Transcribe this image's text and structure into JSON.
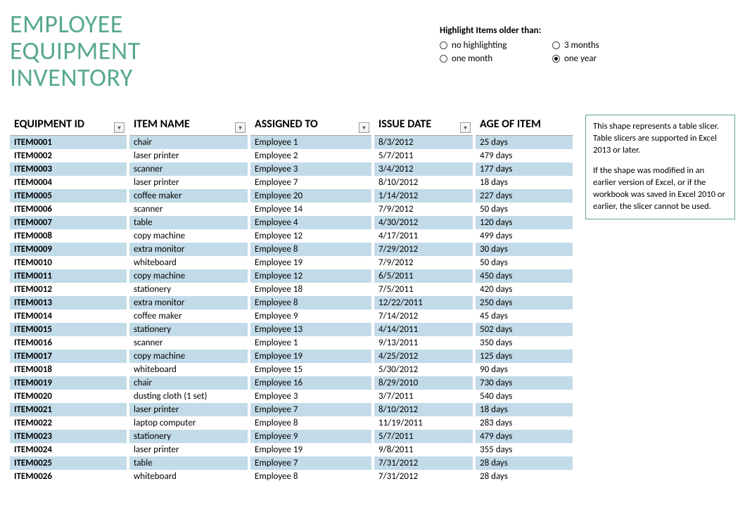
{
  "title_line1": "EMPLOYEE",
  "title_line2": "EQUIPMENT",
  "title_line3": "INVENTORY",
  "highlight": {
    "label": "Highlight Items older than:",
    "options": [
      {
        "label": "no highlighting",
        "checked": false
      },
      {
        "label": "3 months",
        "checked": false
      },
      {
        "label": "one month",
        "checked": false
      },
      {
        "label": "one year",
        "checked": true
      }
    ]
  },
  "columns": [
    "EQUIPMENT ID",
    "ITEM NAME",
    "ASSIGNED TO",
    "ISSUE DATE",
    "AGE OF ITEM"
  ],
  "rows": [
    {
      "id": "ITEM0001",
      "name": "chair",
      "assigned": "Employee 1",
      "date": "8/3/2012",
      "age": "25 days"
    },
    {
      "id": "ITEM0002",
      "name": "laser printer",
      "assigned": "Employee 2",
      "date": "5/7/2011",
      "age": "479 days"
    },
    {
      "id": "ITEM0003",
      "name": "scanner",
      "assigned": "Employee 3",
      "date": "3/4/2012",
      "age": "177 days"
    },
    {
      "id": "ITEM0004",
      "name": "laser printer",
      "assigned": "Employee 7",
      "date": "8/10/2012",
      "age": "18 days"
    },
    {
      "id": "ITEM0005",
      "name": "coffee maker",
      "assigned": "Employee 20",
      "date": "1/14/2012",
      "age": "227 days"
    },
    {
      "id": "ITEM0006",
      "name": "scanner",
      "assigned": "Employee 14",
      "date": "7/9/2012",
      "age": "50 days"
    },
    {
      "id": "ITEM0007",
      "name": "table",
      "assigned": "Employee 4",
      "date": "4/30/2012",
      "age": "120 days"
    },
    {
      "id": "ITEM0008",
      "name": "copy machine",
      "assigned": "Employee 12",
      "date": "4/17/2011",
      "age": "499 days"
    },
    {
      "id": "ITEM0009",
      "name": "extra monitor",
      "assigned": "Employee 8",
      "date": "7/29/2012",
      "age": "30 days"
    },
    {
      "id": "ITEM0010",
      "name": "whiteboard",
      "assigned": "Employee 19",
      "date": "7/9/2012",
      "age": "50 days"
    },
    {
      "id": "ITEM0011",
      "name": "copy machine",
      "assigned": "Employee 12",
      "date": "6/5/2011",
      "age": "450 days"
    },
    {
      "id": "ITEM0012",
      "name": "stationery",
      "assigned": "Employee 18",
      "date": "7/5/2011",
      "age": "420 days"
    },
    {
      "id": "ITEM0013",
      "name": "extra monitor",
      "assigned": "Employee 8",
      "date": "12/22/2011",
      "age": "250 days"
    },
    {
      "id": "ITEM0014",
      "name": "coffee maker",
      "assigned": "Employee 9",
      "date": "7/14/2012",
      "age": "45 days"
    },
    {
      "id": "ITEM0015",
      "name": "stationery",
      "assigned": "Employee 13",
      "date": "4/14/2011",
      "age": "502 days"
    },
    {
      "id": "ITEM0016",
      "name": "scanner",
      "assigned": "Employee 1",
      "date": "9/13/2011",
      "age": "350 days"
    },
    {
      "id": "ITEM0017",
      "name": "copy machine",
      "assigned": "Employee 19",
      "date": "4/25/2012",
      "age": "125 days"
    },
    {
      "id": "ITEM0018",
      "name": "whiteboard",
      "assigned": "Employee 15",
      "date": "5/30/2012",
      "age": "90 days"
    },
    {
      "id": "ITEM0019",
      "name": "chair",
      "assigned": "Employee 16",
      "date": "8/29/2010",
      "age": "730 days"
    },
    {
      "id": "ITEM0020",
      "name": "dusting cloth (1 set)",
      "assigned": "Employee 3",
      "date": "3/7/2011",
      "age": "540 days"
    },
    {
      "id": "ITEM0021",
      "name": "laser printer",
      "assigned": "Employee 7",
      "date": "8/10/2012",
      "age": "18 days"
    },
    {
      "id": "ITEM0022",
      "name": "laptop computer",
      "assigned": "Employee 8",
      "date": "11/19/2011",
      "age": "283 days"
    },
    {
      "id": "ITEM0023",
      "name": "stationery",
      "assigned": "Employee 9",
      "date": "5/7/2011",
      "age": "479 days"
    },
    {
      "id": "ITEM0024",
      "name": "laser printer",
      "assigned": "Employee 19",
      "date": "9/8/2011",
      "age": "355 days"
    },
    {
      "id": "ITEM0025",
      "name": "table",
      "assigned": "Employee 7",
      "date": "7/31/2012",
      "age": "28 days"
    },
    {
      "id": "ITEM0026",
      "name": "whiteboard",
      "assigned": "Employee 8",
      "date": "7/31/2012",
      "age": "28 days"
    }
  ],
  "slicer": {
    "p1": "This shape represents a table slicer. Table slicers are supported in Excel 2013 or later.",
    "p2": "If the shape was modified in an earlier version of Excel, or if the workbook was saved in Excel 2010 or earlier, the slicer cannot be used."
  }
}
